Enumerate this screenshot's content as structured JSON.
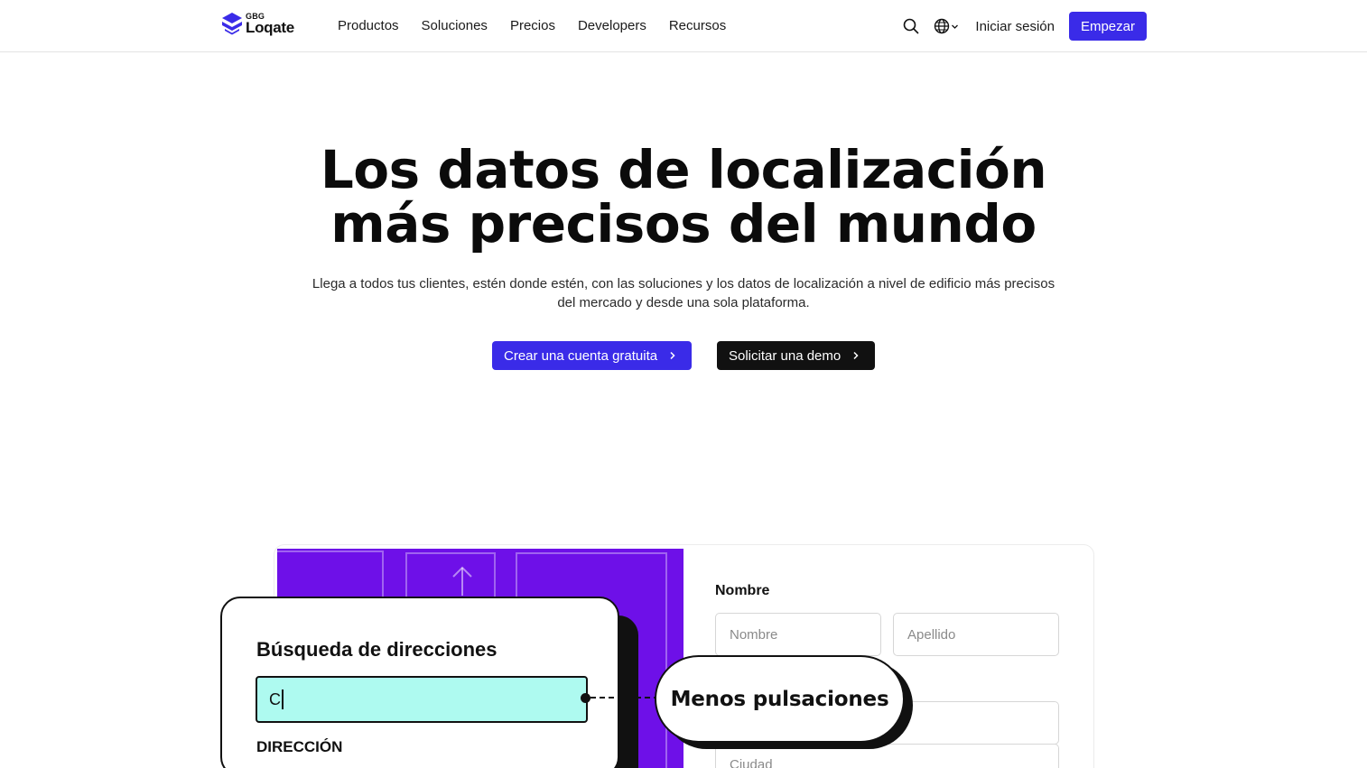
{
  "brand": {
    "gbg": "GBG",
    "name": "Loqate",
    "color": "#3a2be8"
  },
  "nav": {
    "items": [
      {
        "label": "Productos"
      },
      {
        "label": "Soluciones"
      },
      {
        "label": "Precios"
      },
      {
        "label": "Developers"
      },
      {
        "label": "Recursos"
      }
    ]
  },
  "header_right": {
    "search_icon": "search-icon",
    "language_icon": "globe-icon",
    "login_label": "Iniciar sesión",
    "start_label": "Empezar"
  },
  "hero": {
    "title_line1": "Los datos de localización",
    "title_line2": "más precisos del mundo",
    "subtitle": "Llega a todos tus clientes, estén donde estén, con las soluciones y los datos de localización a nivel de edificio más precisos del mercado y desde una sola plataforma.",
    "cta_primary": "Crear una cuenta gratuita",
    "cta_secondary": "Solicitar una demo"
  },
  "demo": {
    "card_title": "Búsqueda de direcciones",
    "input_value": "C",
    "address_label": "DIRECCIÓN",
    "pill_text": "Menos pulsaciones",
    "accent_purple": "#6e10e8",
    "input_bg": "#aefaf0",
    "form": {
      "name_label": "Nombre",
      "first_placeholder": "Nombre",
      "last_placeholder": "Apellido",
      "city_placeholder": "Ciudad"
    }
  }
}
